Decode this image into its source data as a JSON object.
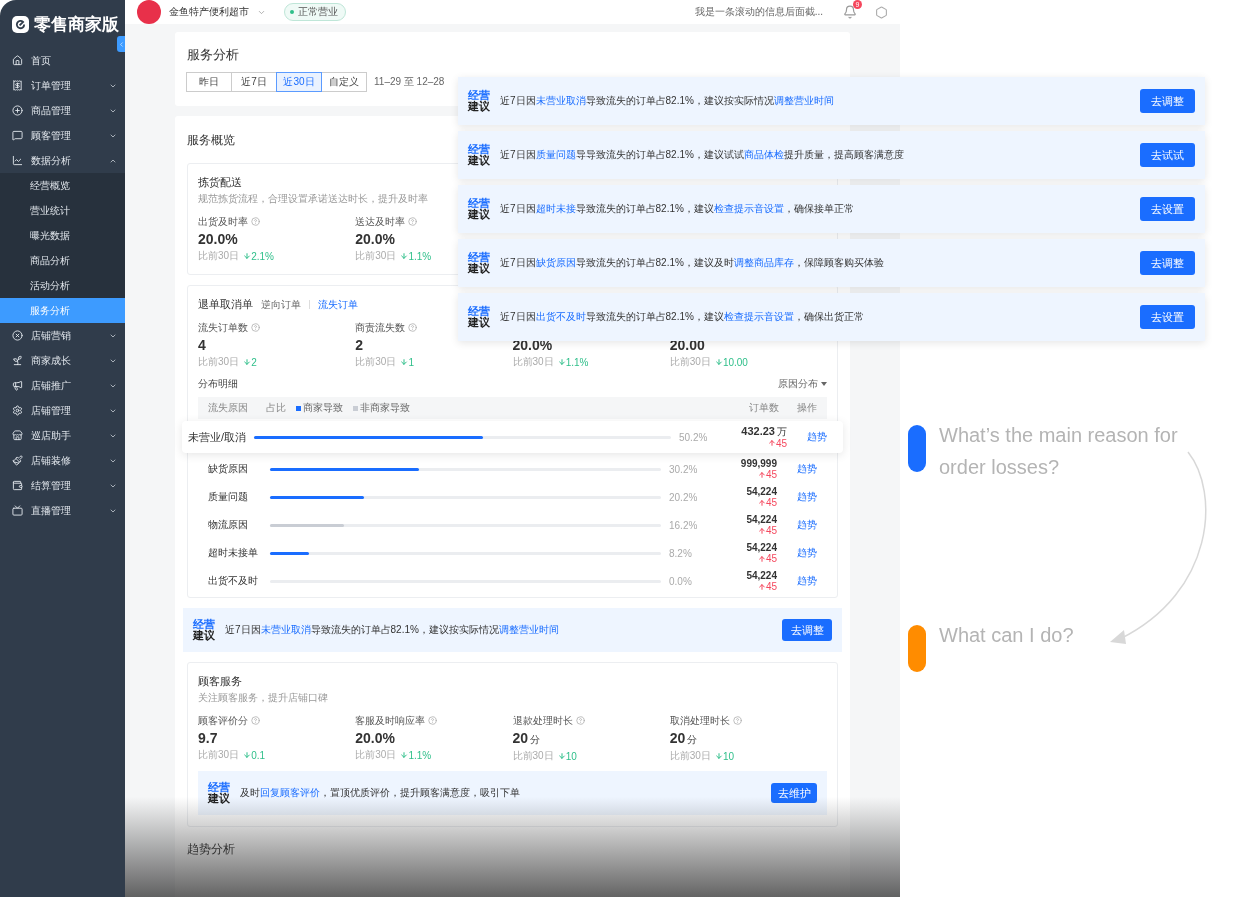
{
  "brand": "零售商家版",
  "sidebar": {
    "items": [
      {
        "label": "首页",
        "selected": false
      },
      {
        "label": "订单管理",
        "selected": false,
        "expanded": false
      },
      {
        "label": "商品管理",
        "selected": false,
        "expanded": false
      },
      {
        "label": "顾客管理",
        "selected": false,
        "expanded": false
      },
      {
        "label": "数据分析",
        "selected": false,
        "expanded": true,
        "children": [
          {
            "label": "经营概览",
            "selected": false
          },
          {
            "label": "营业统计",
            "selected": false
          },
          {
            "label": "曝光数据",
            "selected": false
          },
          {
            "label": "商品分析",
            "selected": false
          },
          {
            "label": "活动分析",
            "selected": false
          },
          {
            "label": "服务分析",
            "selected": true
          }
        ]
      },
      {
        "label": "店铺营销",
        "selected": false,
        "expanded": false
      },
      {
        "label": "商家成长",
        "selected": false,
        "expanded": false
      },
      {
        "label": "店铺推广",
        "selected": false,
        "expanded": false
      },
      {
        "label": "店铺管理",
        "selected": false,
        "expanded": false
      },
      {
        "label": "巡店助手",
        "selected": false,
        "expanded": false
      },
      {
        "label": "店铺装修",
        "selected": false,
        "expanded": false
      },
      {
        "label": "结算管理",
        "selected": false,
        "expanded": false
      },
      {
        "label": "直播管理",
        "selected": false,
        "expanded": false
      }
    ]
  },
  "header": {
    "store_name": "金鱼特产便利超市",
    "status": "正常营业",
    "marquee": "我是一条滚动的信息后面截...",
    "notification_count": "9"
  },
  "page": {
    "title": "服务分析",
    "ranges": [
      {
        "label": "昨日",
        "selected": false
      },
      {
        "label": "近7日",
        "selected": false
      },
      {
        "label": "近30日",
        "selected": true
      },
      {
        "label": "自定义",
        "selected": false
      }
    ],
    "date_range": "11–29 至 12–28"
  },
  "overview": {
    "title": "服务概览",
    "picking": {
      "title": "拣货配送",
      "description": "规范拣货流程，合理设置承诺送达时长，提升及时率",
      "metrics": [
        {
          "label": "出货及时率",
          "value": "20.0%",
          "compare": "比前30日",
          "delta": "2.1%",
          "rising": false
        },
        {
          "label": "送达及时率",
          "value": "20.0%",
          "compare": "比前30日",
          "delta": "1.1%",
          "rising": false
        }
      ]
    },
    "cancellations": {
      "title": "退单取消单",
      "tabs": [
        {
          "label": "逆向订单",
          "selected": false
        },
        {
          "label": "流失订单",
          "selected": true
        }
      ],
      "metrics": [
        {
          "label": "流失订单数",
          "value": "4",
          "compare": "比前30日",
          "delta": "2",
          "rising": false
        },
        {
          "label": "商责流失数",
          "value": "2",
          "compare": "比前30日",
          "delta": "1",
          "rising": false
        },
        {
          "value": "20.0%",
          "compare": "比前30日",
          "delta": "1.1%",
          "rising": false
        },
        {
          "value": "20.00",
          "compare": "比前30日",
          "delta": "10.00",
          "rising": false
        }
      ],
      "distribution": {
        "title": "分布明细",
        "dropdown": "原因分布",
        "columns": {
          "reason": "流失原因",
          "share": "占比",
          "legend": [
            {
              "label": "商家导致",
              "color": "#1a6dff"
            },
            {
              "label": "非商家导致",
              "color": "#c9cdd4"
            }
          ],
          "count": "订单数",
          "action": "操作"
        },
        "rows": [
          {
            "reason": "未营业/取消",
            "kind": "merchant",
            "level": 0.55,
            "percent": "50.2%",
            "count": "432.23",
            "unit": "万",
            "delta": "45",
            "rising": true,
            "action": "趋势",
            "selected": true
          },
          {
            "reason": "缺货原因",
            "kind": "merchant",
            "level": 0.38,
            "percent": "30.2%",
            "count": "999,999",
            "delta": "45",
            "rising": true,
            "action": "趋势",
            "selected": false
          },
          {
            "reason": "质量问题",
            "kind": "merchant",
            "level": 0.24,
            "percent": "20.2%",
            "count": "54,224",
            "delta": "45",
            "rising": true,
            "action": "趋势",
            "selected": false
          },
          {
            "reason": "物流原因",
            "kind": "other",
            "level": 0.19,
            "percent": "16.2%",
            "count": "54,224",
            "delta": "45",
            "rising": true,
            "action": "趋势",
            "selected": false
          },
          {
            "reason": "超时未接单",
            "kind": "merchant",
            "level": 0.1,
            "percent": "8.2%",
            "count": "54,224",
            "delta": "45",
            "rising": true,
            "action": "趋势",
            "selected": false
          },
          {
            "reason": "出货不及时",
            "kind": "merchant",
            "level": 0,
            "percent": "0.0%",
            "count": "54,224",
            "delta": "45",
            "rising": true,
            "action": "趋势",
            "selected": false
          }
        ]
      },
      "advice": {
        "badge_top": "经营",
        "badge_bottom": "建议",
        "parts": [
          {
            "text": "近7日因",
            "kind": "text"
          },
          {
            "text": "未营业取消",
            "kind": "link"
          },
          {
            "text": "导致流失的订单占82.1%，建议按实际情况",
            "kind": "text"
          },
          {
            "text": "调整营业时间",
            "kind": "link"
          }
        ],
        "button": "去调整"
      }
    },
    "customer_service": {
      "title": "顾客服务",
      "description": "关注顾客服务，提升店铺口碑",
      "metrics": [
        {
          "label": "顾客评价分",
          "value": "9.7",
          "compare": "比前30日",
          "delta": "0.1",
          "rising": false
        },
        {
          "label": "客服及时响应率",
          "value": "20.0%",
          "compare": "比前30日",
          "delta": "1.1%",
          "rising": false
        },
        {
          "label": "退款处理时长",
          "value": "20",
          "unit": "分",
          "compare": "比前30日",
          "delta": "10",
          "rising": false
        },
        {
          "label": "取消处理时长",
          "value": "20",
          "unit": "分",
          "compare": "比前30日",
          "delta": "10",
          "rising": false
        }
      ],
      "advice": {
        "badge_top": "经营",
        "badge_bottom": "建议",
        "parts": [
          {
            "text": "及时",
            "kind": "text"
          },
          {
            "text": "回复顾客评价",
            "kind": "link"
          },
          {
            "text": "，置顶优质评价，提升顾客满意度，吸引下单",
            "kind": "text"
          }
        ],
        "button": "去维护"
      }
    },
    "trend_title": "趋势分析"
  },
  "suggestions": [
    {
      "badge_top": "经营",
      "badge_bottom": "建议",
      "parts": [
        {
          "text": "近7日因",
          "kind": "text"
        },
        {
          "text": "未营业取消",
          "kind": "link"
        },
        {
          "text": "导致流失的订单占82.1%，建议按实际情况",
          "kind": "text"
        },
        {
          "text": "调整营业时间",
          "kind": "link"
        }
      ],
      "button": "去调整"
    },
    {
      "badge_top": "经营",
      "badge_bottom": "建议",
      "parts": [
        {
          "text": "近7日因",
          "kind": "text"
        },
        {
          "text": "质量问题",
          "kind": "link"
        },
        {
          "text": "导导致流失的订单占82.1%，建议试试",
          "kind": "text"
        },
        {
          "text": "商品体检",
          "kind": "link"
        },
        {
          "text": "提升质量，提高顾客满意度",
          "kind": "text"
        }
      ],
      "button": "去试试"
    },
    {
      "badge_top": "经营",
      "badge_bottom": "建议",
      "parts": [
        {
          "text": "近7日因",
          "kind": "text"
        },
        {
          "text": "超时未接",
          "kind": "link"
        },
        {
          "text": "导致流失的订单占82.1%，建议",
          "kind": "text"
        },
        {
          "text": "检查提示音设置",
          "kind": "link"
        },
        {
          "text": "，确保接单正常",
          "kind": "text"
        }
      ],
      "button": "去设置"
    },
    {
      "badge_top": "经营",
      "badge_bottom": "建议",
      "parts": [
        {
          "text": "近7日因",
          "kind": "text"
        },
        {
          "text": "缺货原因",
          "kind": "link"
        },
        {
          "text": "导致流失的订单占82.1%，建议及时",
          "kind": "text"
        },
        {
          "text": "调整商品库存",
          "kind": "link"
        },
        {
          "text": "，保障顾客购买体验",
          "kind": "text"
        }
      ],
      "button": "去调整"
    },
    {
      "badge_top": "经营",
      "badge_bottom": "建议",
      "parts": [
        {
          "text": "近7日因",
          "kind": "text"
        },
        {
          "text": "出货不及时",
          "kind": "link"
        },
        {
          "text": "导致流失的订单占82.1%，建议",
          "kind": "text"
        },
        {
          "text": "检查提示音设置",
          "kind": "link"
        },
        {
          "text": "，确保出货正常",
          "kind": "text"
        }
      ],
      "button": "去设置"
    }
  ],
  "annotations": [
    {
      "text": "What’s the main reason for order losses?",
      "color": "#1a6dff"
    },
    {
      "text": "What can I do?",
      "color": "#ff8c00"
    }
  ]
}
